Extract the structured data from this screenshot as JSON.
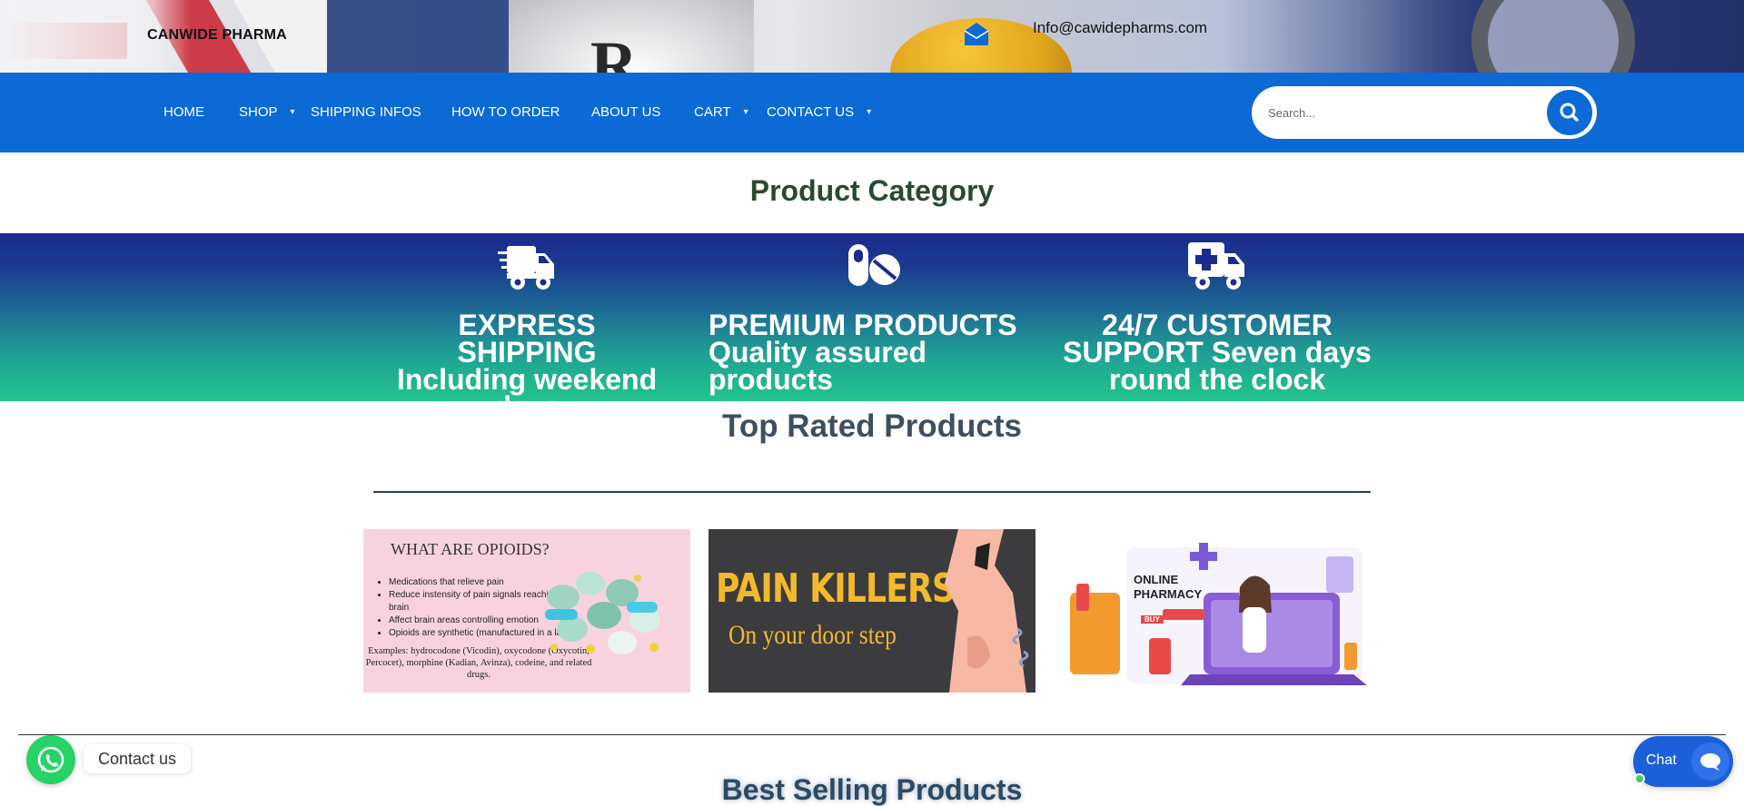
{
  "header": {
    "brand": "CANWIDE PHARMA",
    "email": "Info@cawidepharms.com"
  },
  "nav": {
    "items": [
      {
        "label": "HOME",
        "has_dropdown": false
      },
      {
        "label": "SHOP",
        "has_dropdown": true
      },
      {
        "label": "SHIPPING INFOS",
        "has_dropdown": false
      },
      {
        "label": "HOW TO ORDER",
        "has_dropdown": false
      },
      {
        "label": "ABOUT US",
        "has_dropdown": false
      },
      {
        "label": "CART",
        "has_dropdown": true
      },
      {
        "label": "CONTACT US",
        "has_dropdown": true
      }
    ],
    "search_placeholder": "Search..."
  },
  "sections": {
    "category_title": "Product Category",
    "top_rated_title": "Top Rated Products",
    "best_selling_title": "Best Selling Products"
  },
  "features": [
    {
      "icon": "truck-fast-icon",
      "lines": [
        "EXPRESS SHIPPING",
        "Including weekend",
        "days"
      ]
    },
    {
      "icon": "pills-icon",
      "lines": [
        "PREMIUM PRODUCTS",
        "Quality assured",
        "products"
      ]
    },
    {
      "icon": "ambulance-icon",
      "lines": [
        "24/7 CUSTOMER",
        "SUPPORT Seven days",
        "round the clock"
      ]
    }
  ],
  "products": [
    {
      "title": "WHAT ARE OPIOIDS?",
      "bullets": [
        "Medications that relieve pain",
        "Reduce instensity of pain signals reaching the brain",
        "Affect brain areas controlling emotion",
        "Opioids are synthetic (manufactured in a lab)"
      ],
      "examples": "Examples: hydrocodone (Vicodin), oxycodone (Oxycotin, Percocet), morphine (Kadian, Avinza), codeine, and related drugs."
    },
    {
      "line1": "PAIN KILLERS",
      "line2": "On your door step"
    },
    {
      "line1": "ONLINE",
      "line2": "PHARMACY",
      "badge": "BUY"
    }
  ],
  "widgets": {
    "whatsapp_label": "Contact us",
    "chat_label": "Chat"
  },
  "colors": {
    "nav_bg": "#0b6ad6",
    "feature_gradient_top": "#1b2b8e",
    "feature_gradient_bottom": "#21c48d",
    "whatsapp": "#25d366",
    "chat": "#1b5fd9"
  }
}
